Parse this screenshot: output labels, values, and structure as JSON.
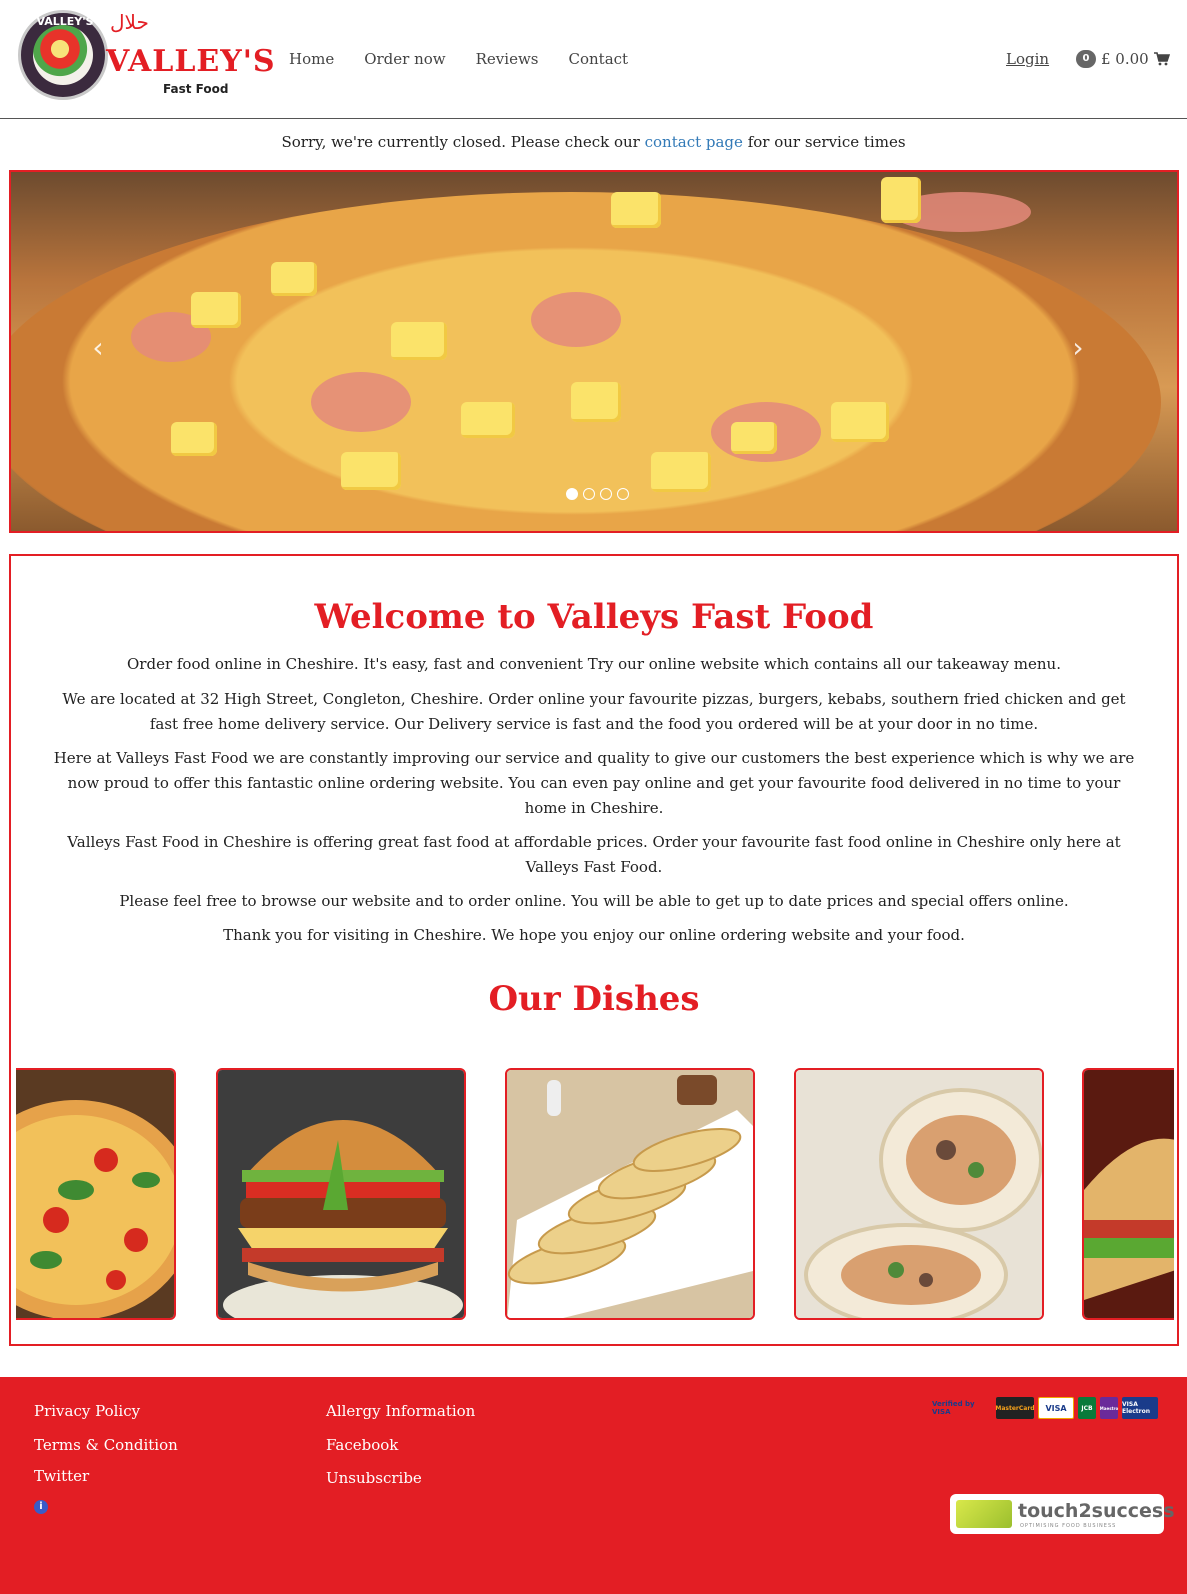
{
  "brand": {
    "name": "VALLEY'S",
    "subtitle": "Fast Food",
    "badge_text": "VALLEY'S",
    "halal": "حلال"
  },
  "nav": {
    "items": [
      {
        "label": "Home"
      },
      {
        "label": "Order now"
      },
      {
        "label": "Reviews"
      },
      {
        "label": "Contact"
      }
    ],
    "login": "Login",
    "cart_count": "0",
    "cart_total": "£ 0.00"
  },
  "notice": {
    "prefix": "Sorry, we're currently closed. Please check our ",
    "link": "contact page",
    "suffix": " for our service times"
  },
  "carousel": {
    "slide_count": 4,
    "active_index": 0,
    "prev_icon": "chevron-left-icon",
    "next_icon": "chevron-right-icon"
  },
  "welcome": {
    "title": "Welcome to Valleys Fast Food",
    "paragraphs": [
      "Order food online in Cheshire. It's easy, fast and convenient Try our online website which contains all our takeaway menu.",
      "We are located at 32 High Street, Congleton, Cheshire. Order online your favourite pizzas, burgers, kebabs, southern fried chicken and get fast free home delivery service. Our Delivery service is fast and the food you ordered will be at your door in no time.",
      "Here at Valleys Fast Food we are constantly improving our service and quality to give our customers the best experience which is why we are now proud to offer this fantastic online ordering website. You can even pay online and get your favourite food delivered in no time to your home in Cheshire.",
      "Valleys Fast Food in Cheshire is offering great fast food at affordable prices. Order your favourite fast food online in Cheshire only here at Valleys Fast Food.",
      "Please feel free to browse our website and to order online. You will be able to get up to date prices and special offers online.",
      "Thank you for visiting in Cheshire. We hope you enjoy our online ordering website and your food."
    ],
    "dishes_title": "Our Dishes"
  },
  "footer": {
    "col1": [
      "Privacy Policy",
      "Terms & Condition",
      "Twitter"
    ],
    "col2": [
      "Allergy Information",
      "Facebook",
      "Unsubscribe"
    ],
    "payments": [
      "Verified by VISA",
      "MasterCard",
      "VISA",
      "JCB",
      "Maestro",
      "VISA Electron"
    ],
    "partner": {
      "name": "touch2success",
      "tagline": "OPTIMISING FOOD BUSINESS"
    }
  },
  "colors": {
    "brand_red": "#e31e24",
    "link_blue": "#337ab7",
    "text": "#222222"
  }
}
